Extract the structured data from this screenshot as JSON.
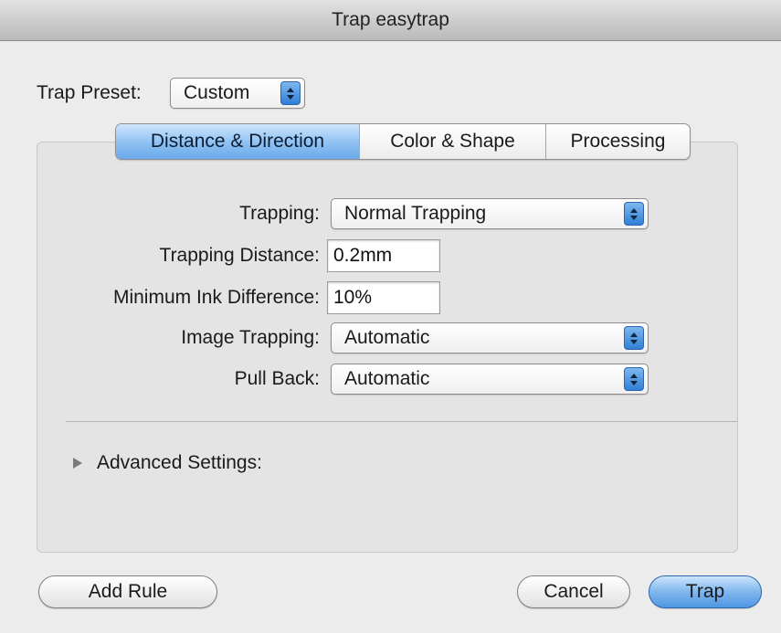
{
  "window": {
    "title": "Trap easytrap"
  },
  "preset": {
    "label": "Trap Preset:",
    "value": "Custom"
  },
  "tabs": [
    {
      "label": "Distance & Direction",
      "active": true
    },
    {
      "label": "Color & Shape",
      "active": false
    },
    {
      "label": "Processing",
      "active": false
    }
  ],
  "settings": {
    "trapping": {
      "label": "Trapping:",
      "value": "Normal Trapping"
    },
    "trapping_distance": {
      "label": "Trapping Distance:",
      "value": "0.2mm"
    },
    "min_ink_diff": {
      "label": "Minimum Ink Difference:",
      "value": "10%"
    },
    "image_trapping": {
      "label": "Image Trapping:",
      "value": "Automatic"
    },
    "pull_back": {
      "label": "Pull Back:",
      "value": "Automatic"
    }
  },
  "advanced": {
    "label": "Advanced Settings:"
  },
  "buttons": {
    "add_rule": "Add Rule",
    "cancel": "Cancel",
    "trap": "Trap"
  },
  "colors": {
    "accent": "#6aa9ea",
    "window_bg": "#ececec",
    "panel_bg": "#e4e4e4"
  },
  "icons": {
    "popup": "updown-arrows-icon",
    "disclosure": "disclosure-triangle-right-icon"
  }
}
